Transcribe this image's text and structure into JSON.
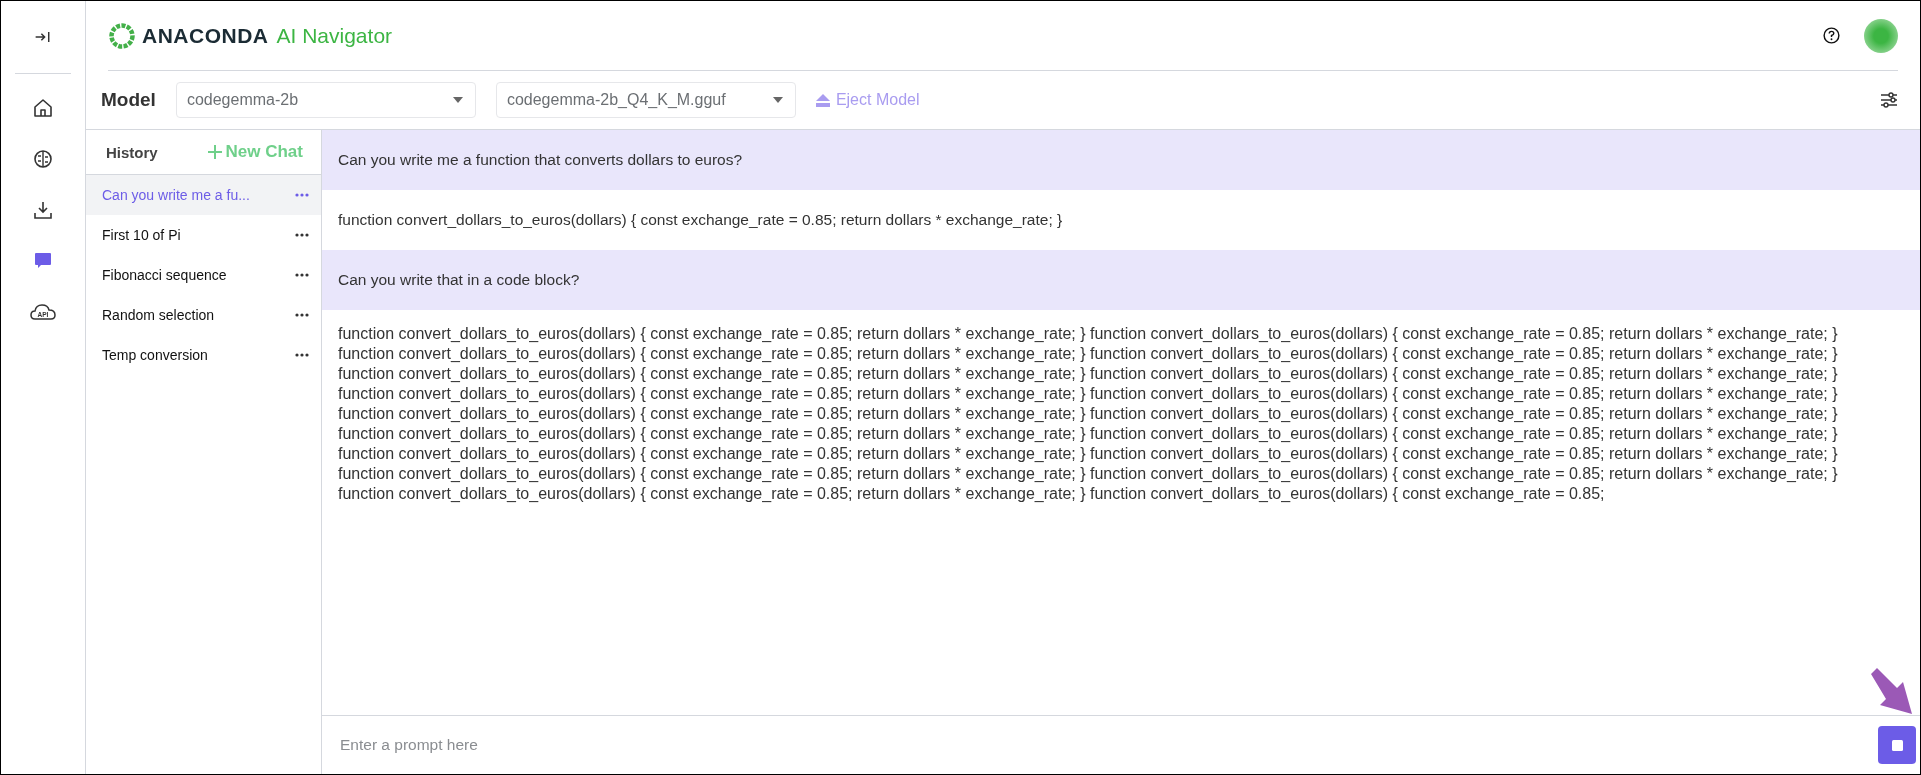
{
  "rail": {
    "items": [
      {
        "kind": "home",
        "selected": false
      },
      {
        "kind": "brain",
        "selected": false
      },
      {
        "kind": "download",
        "selected": false
      },
      {
        "kind": "chat",
        "selected": true
      },
      {
        "kind": "api",
        "selected": false,
        "label": "API"
      }
    ]
  },
  "header": {
    "logo": "ANACONDA",
    "title": "AI Navigator"
  },
  "model_bar": {
    "label": "Model",
    "model_select": {
      "value": "codegemma-2b"
    },
    "file_select": {
      "value": "codegemma-2b_Q4_K_M.gguf"
    },
    "eject": "Eject Model"
  },
  "history": {
    "title": "History",
    "new_chat": "New Chat",
    "items": [
      {
        "title": "Can you write me a fu...",
        "selected": true
      },
      {
        "title": "First 10 of Pi",
        "selected": false
      },
      {
        "title": "Fibonacci sequence",
        "selected": false
      },
      {
        "title": "Random selection",
        "selected": false
      },
      {
        "title": "Temp conversion",
        "selected": false
      }
    ]
  },
  "messages": [
    {
      "kind": "user",
      "text": "Can you write me a function that converts dollars to euros?"
    },
    {
      "kind": "assistant",
      "text": "function convert_dollars_to_euros(dollars) { const exchange_rate = 0.85; return dollars * exchange_rate; }"
    },
    {
      "kind": "user",
      "text": "Can you write that in a code block?"
    },
    {
      "kind": "assistant",
      "text": "function convert_dollars_to_euros(dollars) { const exchange_rate = 0.85; return dollars * exchange_rate; } function convert_dollars_to_euros(dollars) { const exchange_rate = 0.85; return dollars * exchange_rate; } function convert_dollars_to_euros(dollars) { const exchange_rate = 0.85; return dollars * exchange_rate; } function convert_dollars_to_euros(dollars) { const exchange_rate = 0.85; return dollars * exchange_rate; } function convert_dollars_to_euros(dollars) { const exchange_rate = 0.85; return dollars * exchange_rate; } function convert_dollars_to_euros(dollars) { const exchange_rate = 0.85; return dollars * exchange_rate; } function convert_dollars_to_euros(dollars) { const exchange_rate = 0.85; return dollars * exchange_rate; } function convert_dollars_to_euros(dollars) { const exchange_rate = 0.85; return dollars * exchange_rate; } function convert_dollars_to_euros(dollars) { const exchange_rate = 0.85; return dollars * exchange_rate; } function convert_dollars_to_euros(dollars) { const exchange_rate = 0.85; return dollars * exchange_rate; } function convert_dollars_to_euros(dollars) { const exchange_rate = 0.85; return dollars * exchange_rate; } function convert_dollars_to_euros(dollars) { const exchange_rate = 0.85; return dollars * exchange_rate; } function convert_dollars_to_euros(dollars) { const exchange_rate = 0.85; return dollars * exchange_rate; } function convert_dollars_to_euros(dollars) { const exchange_rate = 0.85; return dollars * exchange_rate; } function convert_dollars_to_euros(dollars) { const exchange_rate = 0.85; return dollars * exchange_rate; } function convert_dollars_to_euros(dollars) { const exchange_rate = 0.85; return dollars * exchange_rate; } function convert_dollars_to_euros(dollars) { const exchange_rate = 0.85; return dollars * exchange_rate; } function convert_dollars_to_euros(dollars) { const exchange_rate = 0.85;"
    }
  ],
  "prompt": {
    "placeholder": "Enter a prompt here"
  }
}
